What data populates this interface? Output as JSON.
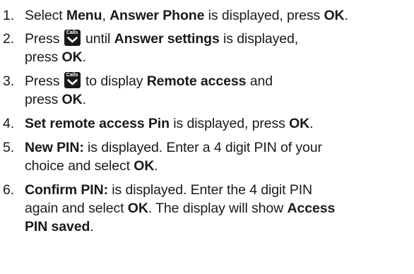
{
  "steps": [
    {
      "num": "1.",
      "t1": "Select ",
      "b1": "Menu",
      "t2": ", ",
      "b2": "Answer Phone",
      "t3": " is displayed, press ",
      "b3": "OK",
      "t4": "."
    },
    {
      "num": "2.",
      "t1": "Press ",
      "t2": " until ",
      "b1": "Answer settings",
      "t3": " is displayed,",
      "t4": "press ",
      "b2": "OK",
      "t5": "."
    },
    {
      "num": "3.",
      "t1": "Press ",
      "t2": " to display ",
      "b1": "Remote access",
      "t3": " and",
      "t4": "press ",
      "b2": "OK",
      "t5": "."
    },
    {
      "num": "4.",
      "b1": "Set remote access Pin",
      "t1": " is displayed, press ",
      "b2": "OK",
      "t2": "."
    },
    {
      "num": "5.",
      "b1": "New PIN:",
      "t1": " is displayed.  Enter a 4 digit PIN of your",
      "t2": "choice and select ",
      "b2": "OK",
      "t3": "."
    },
    {
      "num": "6.",
      "b1": "Confirm PIN:",
      "t1": " is displayed.  Enter the 4 digit PIN",
      "t2": "again and select ",
      "b2": "OK",
      "t3": ". The display will show ",
      "b3": "Access",
      "b4": "PIN saved",
      "t4": "."
    }
  ],
  "calls_key": {
    "label": "Calls",
    "icon": "chevron-down-icon"
  }
}
